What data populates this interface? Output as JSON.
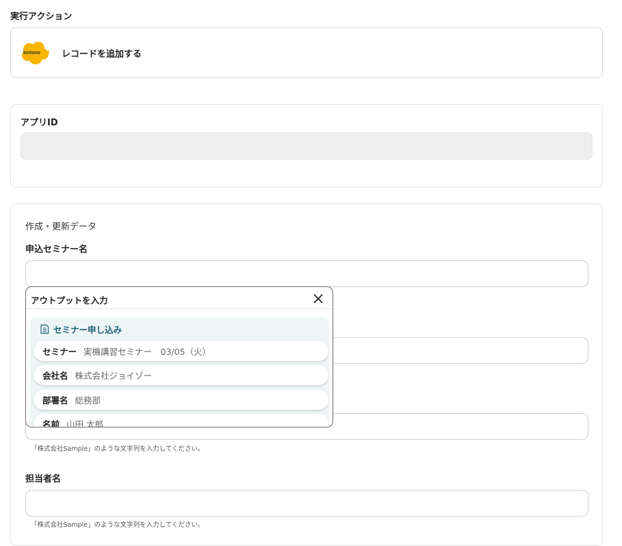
{
  "action_section": {
    "title": "実行アクション",
    "app_logo_text": "kintone",
    "action_label": "レコードを追加する"
  },
  "app_id": {
    "label": "アプリID",
    "value": ""
  },
  "data_section": {
    "heading": "作成・更新データ",
    "fields": [
      {
        "label": "申込セミナー名",
        "value": "",
        "hint": ""
      },
      {
        "label": "",
        "value": "",
        "hint": ""
      },
      {
        "label": "",
        "value": "",
        "hint": "「株式会社Sample」のような文字列を入力してください。"
      },
      {
        "label": "担当者名",
        "value": "",
        "hint": "「株式会社Sample」のような文字列を入力してください。"
      }
    ]
  },
  "output_popup": {
    "title": "アウトプットを入力",
    "group_title": "セミナー申し込み",
    "items": [
      {
        "key": "セミナー",
        "value": "実機講習セミナー　03/05（火）"
      },
      {
        "key": "会社名",
        "value": "株式会社ジョイゾー"
      },
      {
        "key": "部署名",
        "value": "総務部"
      },
      {
        "key": "名前",
        "value": "山田 太郎"
      }
    ]
  },
  "colors": {
    "accent": "#1a5f78",
    "logo_yellow": "#f7b500",
    "border": "#d6d6d6"
  }
}
